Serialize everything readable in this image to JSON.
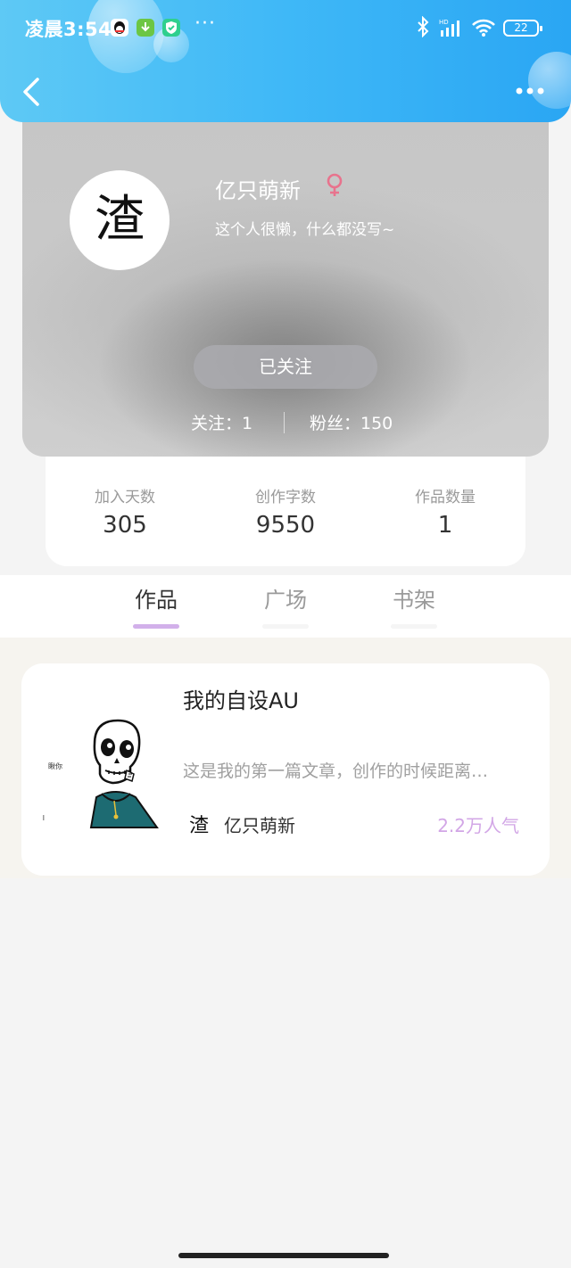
{
  "status_bar": {
    "time": "凌晨3:54",
    "battery": "22",
    "icons": [
      "qq-icon",
      "download-icon",
      "shield-icon",
      "more-dots-icon",
      "bluetooth-icon",
      "signal-hd-icon",
      "wifi-icon",
      "battery-icon"
    ]
  },
  "header": {
    "back_icon": "chevron-left-icon",
    "more_icon": "more-dots-icon",
    "gradient": [
      "#5ec9f5",
      "#2aa6f3"
    ]
  },
  "profile": {
    "avatar_char": "渣",
    "name": "亿只萌新",
    "gender_icon": "female-icon",
    "bio": "这个人很懒，什么都没写~",
    "follow_button": "已关注",
    "following": "关注：1",
    "followers": "粉丝：150"
  },
  "stats": [
    {
      "label": "加入天数",
      "value": "305"
    },
    {
      "label": "创作字数",
      "value": "9550"
    },
    {
      "label": "作品数量",
      "value": "1"
    }
  ],
  "tabs": [
    {
      "label": "作品",
      "active": true
    },
    {
      "label": "广场",
      "active": false
    },
    {
      "label": "书架",
      "active": false
    }
  ],
  "work": {
    "title": "我的自设AU",
    "description": "这是我的第一篇文章，创作的时候距离…",
    "author_avatar_char": "渣",
    "author": "亿只萌新",
    "popularity": "2.2万人气",
    "cover_caption": "瞅你",
    "accent": "#d2a6e6"
  }
}
